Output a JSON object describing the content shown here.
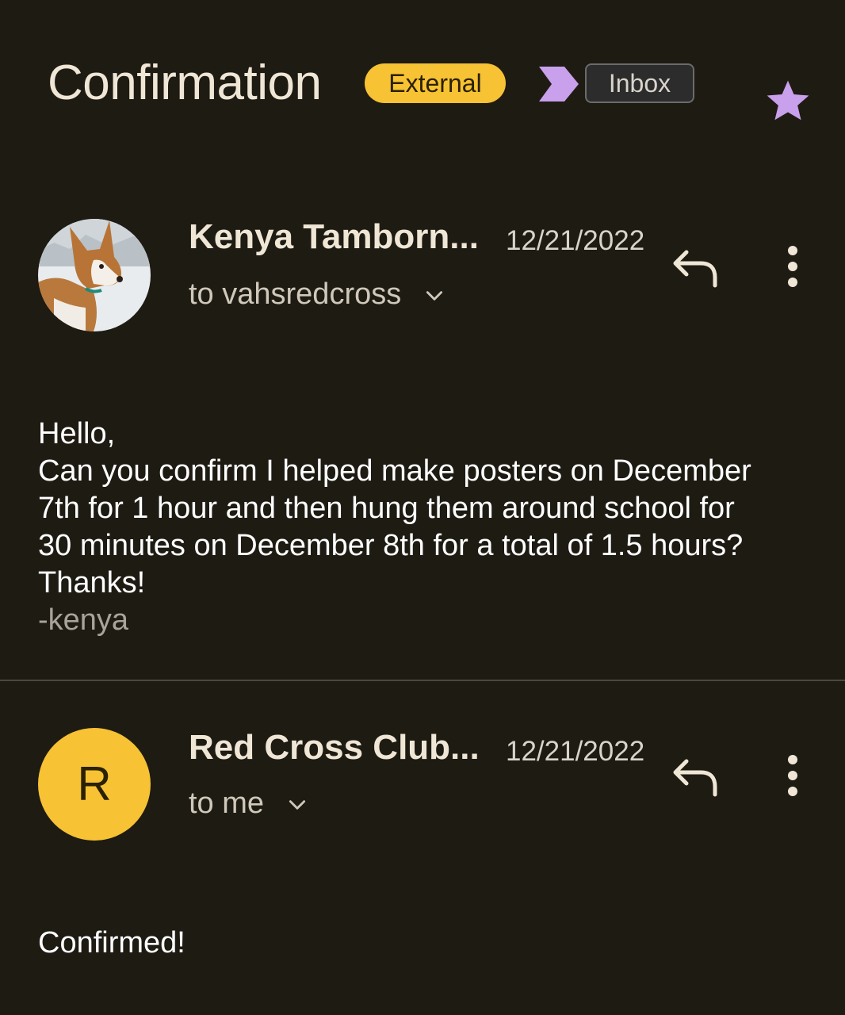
{
  "thread": {
    "subject": "Confirmation",
    "badge_external": "External",
    "label_inbox": "Inbox",
    "starred": true
  },
  "colors": {
    "background": "#1e1b13",
    "badge_yellow": "#f7c233",
    "importance_purple": "#c9a0ec",
    "star_purple": "#c9a0ec",
    "divider": "#4a4740"
  },
  "messages": [
    {
      "sender": "Kenya Tamborn...",
      "date": "12/21/2022",
      "recipients": "to vahsredcross",
      "avatar": "dog-photo",
      "body_lines": [
        "Hello,",
        "Can you confirm I helped make posters on December",
        "7th for 1 hour and then hung them around school for",
        "30 minutes on December 8th for a total of 1.5 hours?",
        "Thanks!"
      ],
      "signature": "-kenya"
    },
    {
      "sender": "Red Cross Club...",
      "date": "12/21/2022",
      "recipients": "to me",
      "avatar_letter": "R",
      "body_lines": [
        "Confirmed!"
      ]
    }
  ],
  "icons": {
    "reply": "reply-icon",
    "more": "more-vert-icon",
    "expand": "chevron-down-icon",
    "star": "star-icon",
    "importance": "importance-marker-icon"
  }
}
